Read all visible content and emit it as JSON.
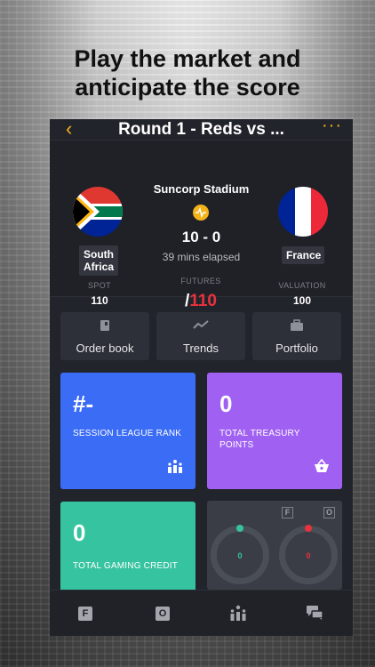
{
  "headline": {
    "line1": "Play the market and",
    "line2": "anticipate the score"
  },
  "nav": {
    "title": "Round 1 - Reds vs ...",
    "back_icon": "chevron-left-icon",
    "more_icon": "more-dots-icon"
  },
  "match": {
    "venue": "Suncorp Stadium",
    "score": "10 - 0",
    "elapsed": "39 mins elapsed",
    "home": {
      "name_line1": "South",
      "name_line2": "Africa"
    },
    "away": {
      "name": "France"
    },
    "spot": {
      "label": "SPOT",
      "value": "110"
    },
    "futures": {
      "label": "FUTURES",
      "slash": "/",
      "value": "110"
    },
    "valuation": {
      "label": "VALUATION",
      "value": "100"
    }
  },
  "actions": [
    {
      "label": "Order book",
      "icon": "book-icon"
    },
    {
      "label": "Trends",
      "icon": "trend-line-icon"
    },
    {
      "label": "Portfolio",
      "icon": "briefcase-icon"
    }
  ],
  "cards": {
    "rank": {
      "value": "#-",
      "caption": "SESSION LEAGUE RANK",
      "color": "#3b6cf6"
    },
    "treasury": {
      "value": "0",
      "caption_line1": "TOTAL TREASURY",
      "caption_line2": "POINTS",
      "color": "#a061f2"
    },
    "credit": {
      "value": "0",
      "caption": "TOTAL GAMING CREDIT",
      "color": "#36c3a0"
    }
  },
  "gauges": {
    "f_tag": "F",
    "o_tag": "O",
    "f_value": "0",
    "o_value": "0",
    "f_color": "#36c3a0",
    "o_color": "#e8323c"
  },
  "tabs": {
    "f_label": "F",
    "o_label": "O"
  }
}
